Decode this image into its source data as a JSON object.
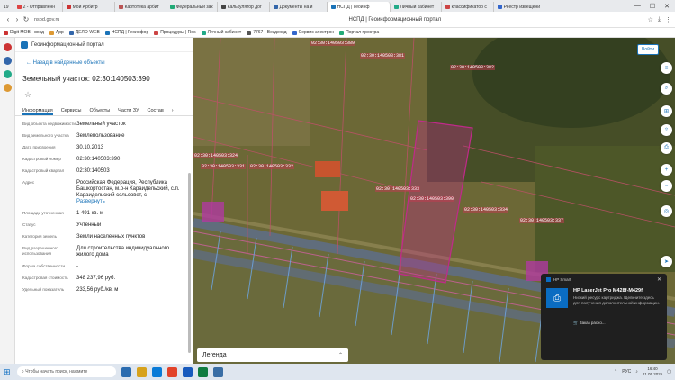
{
  "browser": {
    "tab_counter": "19",
    "tabs": [
      {
        "label": "2 - Отправленн",
        "color": "#d44"
      },
      {
        "label": "Мой Арбитр",
        "color": "#c33"
      },
      {
        "label": "Картотека арбит",
        "color": "#b55"
      },
      {
        "label": "Федеральный зак",
        "color": "#2a7"
      },
      {
        "label": "Калькулятор дог",
        "color": "#444"
      },
      {
        "label": "Документы на и",
        "color": "#36a"
      },
      {
        "label": "НСПД | Геоинф",
        "color": "#1a73b8"
      },
      {
        "label": "Личный кабинет",
        "color": "#2a8"
      },
      {
        "label": "классификатор с",
        "color": "#c44"
      },
      {
        "label": "Реестр извещени",
        "color": "#36c"
      }
    ],
    "window_controls": [
      "—",
      "☐",
      "✕"
    ],
    "url": "nspd.gov.ru",
    "page_title": "НСПД | Геоинформационный портал",
    "bookmarks": [
      {
        "label": "Digit МОВ - вход",
        "color": "#c33"
      },
      {
        "label": "Арр",
        "color": "#d93"
      },
      {
        "label": "ДЕЛО-WEB",
        "color": "#36a"
      },
      {
        "label": "НСПД | Геоинфор",
        "color": "#1a73b8"
      },
      {
        "label": "Процедуры | Ros",
        "color": "#c44"
      },
      {
        "label": "Личный кабинет",
        "color": "#2a8"
      },
      {
        "label": "7767 - Вездеход",
        "color": "#555"
      },
      {
        "label": "Сервис электрон",
        "color": "#36c"
      },
      {
        "label": "Портал простра",
        "color": "#2a7"
      }
    ]
  },
  "panel": {
    "portal_name": "Геоинформационный портал",
    "back_link": "Назад в найденные объекты",
    "title": "Земельный участок: 02:30:140503:390",
    "favorite_icon": "☆",
    "tabs": [
      "Информация",
      "Сервисы",
      "Объекты",
      "Части ЗУ",
      "Состав"
    ],
    "properties": [
      {
        "key": "Вид объекта недвижимости",
        "value": "Земельный участок"
      },
      {
        "key": "Вид земельного участка",
        "value": "Землепользование"
      },
      {
        "key": "Дата присвоения",
        "value": "30.10.2013"
      },
      {
        "key": "Кадастровый номер",
        "value": "02:30:140503:390"
      },
      {
        "key": "Кадастровый квартал",
        "value": "02:30:140503"
      },
      {
        "key": "Адрес",
        "value": "Российская Федерация, Республика Башкортостан, м.р-н Караидельский, с.п. Караидельский сельсовет, с",
        "link": "Развернуть"
      },
      {
        "key": "Площадь уточненная",
        "value": "1 491 кв. м"
      },
      {
        "key": "Статус",
        "value": "Учтенный"
      },
      {
        "key": "Категория земель",
        "value": "Земли населенных пунктов"
      },
      {
        "key": "Вид разрешенного использования",
        "value": "Для строительства индивидуального жилого дома"
      },
      {
        "key": "Форма собственности",
        "value": "-"
      },
      {
        "key": "Кадастровая стоимость",
        "value": "348 237,96 руб."
      },
      {
        "key": "Удельный показатель",
        "value": "233,56 руб./кв. м"
      }
    ]
  },
  "map": {
    "login_label": "Войти",
    "legend_label": "Легенда",
    "legend_chevron": "⌃",
    "cadastral_labels": [
      {
        "text": "02:30:140503:389"
      },
      {
        "text": "02:30:140503:381"
      },
      {
        "text": "02:30:140503:382"
      },
      {
        "text": "02:30:140503:331"
      },
      {
        "text": "02:30:140503:324"
      },
      {
        "text": "02:30:140503:332"
      },
      {
        "text": "02:30:140503:333"
      },
      {
        "text": "02:30:140503:390"
      },
      {
        "text": "02:30:140503:334"
      },
      {
        "text": "02:30:140503:337"
      }
    ],
    "selected_color": "#c02a8a"
  },
  "notification": {
    "app": "HP Smart",
    "title": "HP LaserJet Pro M428f-M429f",
    "body": "Низкий ресурс картриджа. Щелкните здесь для получения дополнительной информации.",
    "action": "Заказ расхо..."
  },
  "taskbar": {
    "search_placeholder": "Чтобы начать поиск, нажмите",
    "language": "РУС",
    "time": "16:40",
    "date": "21.05.2025"
  }
}
